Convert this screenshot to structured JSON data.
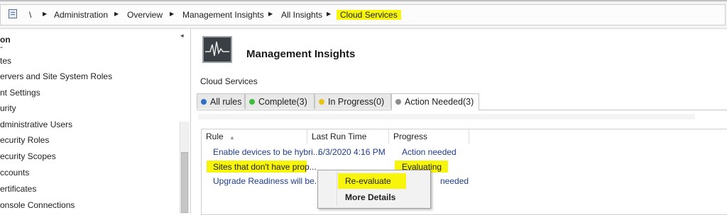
{
  "breadcrumb": {
    "root": "\\",
    "items": [
      "Administration",
      "Overview",
      "Management Insights",
      "All Insights",
      "Cloud Services"
    ]
  },
  "left_nav": {
    "header": "on",
    "items": [
      "-",
      "tes",
      "ervers and Site System Roles",
      "nt Settings",
      "urity",
      "dministrative Users",
      "ecurity Roles",
      "ecurity Scopes",
      "ccounts",
      "ertificates",
      "onsole Connections"
    ]
  },
  "main": {
    "title": "Management Insights",
    "subtitle": "Cloud Services",
    "tabs": [
      {
        "label": "All rules",
        "color": "#2f6fc8"
      },
      {
        "label": "Complete(3)",
        "color": "#3dbb3d"
      },
      {
        "label": "In Progress(0)",
        "color": "#e8c21a"
      },
      {
        "label": "Action Needed(3)",
        "color": "#8c8c8c"
      }
    ],
    "grid": {
      "columns": [
        "Rule",
        "Last Run Time",
        "Progress"
      ],
      "rows": [
        {
          "rule": "Enable devices to be hybri...",
          "last_run": "6/3/2020 4:16 PM",
          "progress": "Action needed"
        },
        {
          "rule": "Sites that don't have prop...",
          "last_run": "",
          "progress": "Evaluating"
        },
        {
          "rule": "Upgrade Readiness will be...",
          "last_run": "",
          "progress": "needed"
        }
      ]
    },
    "context_menu": {
      "items": [
        "Re-evaluate",
        "More Details"
      ]
    }
  },
  "colors": {
    "highlight": "#f7f50c",
    "link": "#1f3c8c"
  }
}
